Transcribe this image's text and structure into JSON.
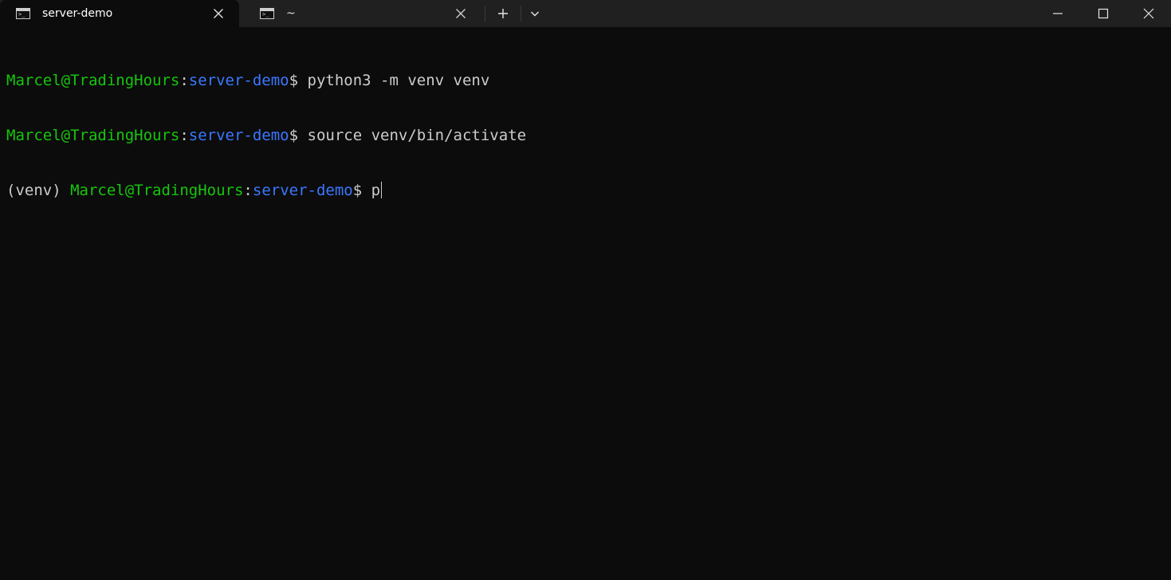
{
  "tabs": [
    {
      "title": "server-demo",
      "active": true,
      "icon": "terminal-icon"
    },
    {
      "title": "~",
      "active": false,
      "icon": "terminal-icon"
    }
  ],
  "toolbar": {
    "new_tab_icon": "plus-icon",
    "dropdown_icon": "chevron-down-icon"
  },
  "window_controls": [
    "minimize-icon",
    "maximize-icon",
    "close-icon"
  ],
  "terminal": {
    "lines": [
      {
        "venv": "",
        "user": "Marcel@TradingHours",
        "sep": ":",
        "path": "server-demo",
        "prompt": "$ ",
        "command": "python3 -m venv venv"
      },
      {
        "venv": "",
        "user": "Marcel@TradingHours",
        "sep": ":",
        "path": "server-demo",
        "prompt": "$ ",
        "command": "source venv/bin/activate"
      },
      {
        "venv": "(venv) ",
        "user": "Marcel@TradingHours",
        "sep": ":",
        "path": "server-demo",
        "prompt": "$ ",
        "command": "p"
      }
    ]
  },
  "colors": {
    "background": "#0c0c0c",
    "tabbar": "#202020",
    "user": "#16c60c",
    "path": "#3b78ff",
    "text": "#cccccc"
  }
}
